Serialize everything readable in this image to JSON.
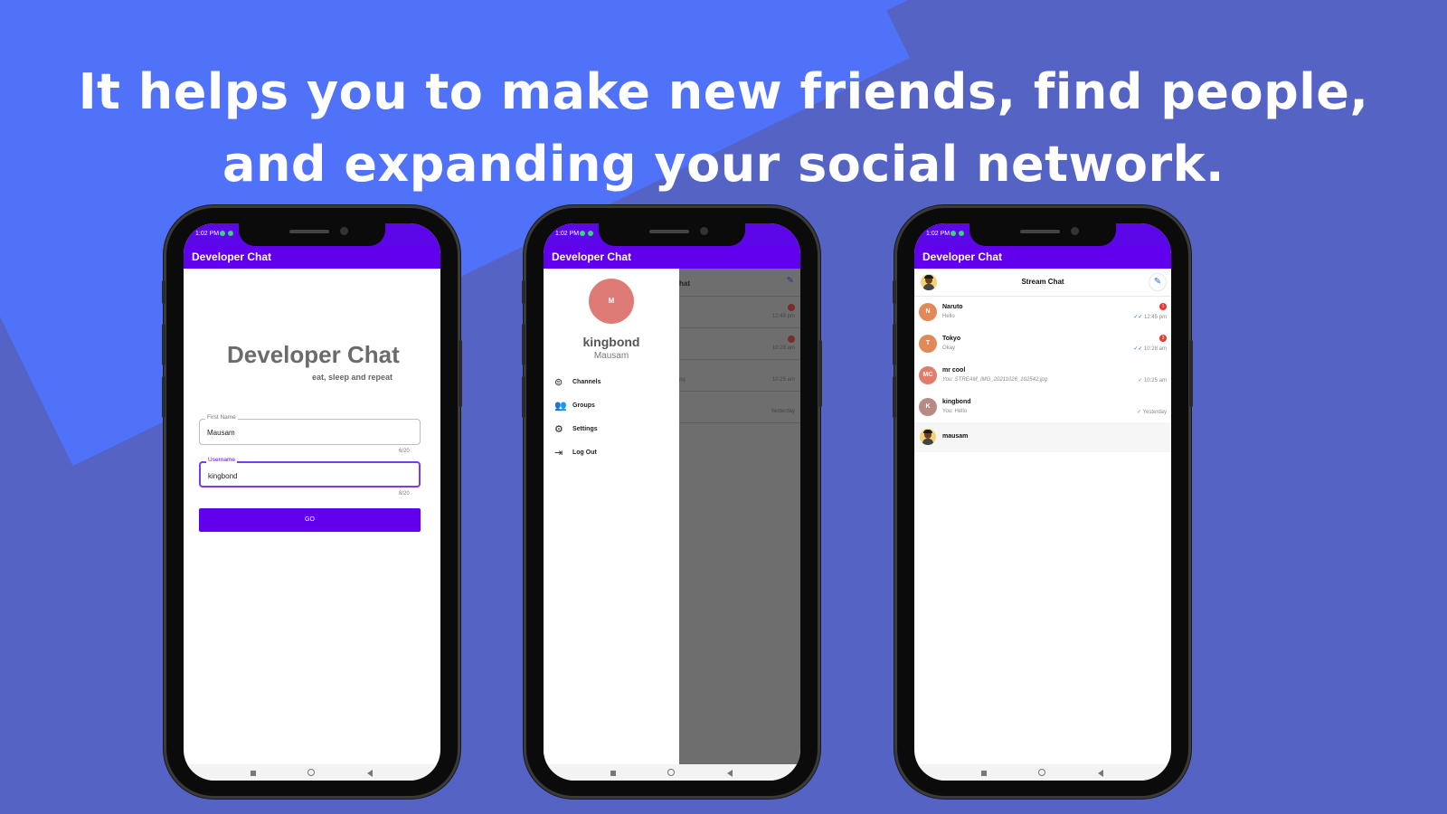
{
  "headline": {
    "line1": "It helps you to make new friends, find people,",
    "line2": "and expanding your social network."
  },
  "colors": {
    "accent": "#6200ee",
    "background": "#4f72f8",
    "unread_badge": "#e53935"
  },
  "status_bar": {
    "time": "1:02 PM"
  },
  "app_bar": {
    "title": "Developer Chat"
  },
  "login": {
    "title": "Developer Chat",
    "subtitle": "eat, sleep and repeat",
    "first_name_label": "First Name",
    "first_name_value": "Mausam",
    "first_name_counter": "6/20",
    "username_label": "Username",
    "username_value": "kingbond",
    "username_counter": "8/20",
    "go_label": "GO"
  },
  "drawer": {
    "avatar_initial": "M",
    "name": "kingbond",
    "username": "Mausam",
    "items": [
      {
        "label": "Channels",
        "icon": "channels-icon"
      },
      {
        "label": "Groups",
        "icon": "groups-icon"
      },
      {
        "label": "Settings",
        "icon": "gear-icon"
      },
      {
        "label": "Log Out",
        "icon": "logout-icon"
      }
    ],
    "background_header_fragment": "hat",
    "background_times": [
      "12:45 pm",
      "10:28 am",
      "10:25 am",
      "Yesterday"
    ],
    "background_msg_fragment": "pg"
  },
  "chat_list": {
    "title": "Stream Chat",
    "rows": [
      {
        "initials": "N",
        "name": "Naruto",
        "message": "Hello",
        "time": "12:45 pm",
        "unread": "1",
        "color": "#e2895a"
      },
      {
        "initials": "T",
        "name": "Tokyo",
        "message": "Okay",
        "time": "10:28 am",
        "unread": "3",
        "color": "#e2895a"
      },
      {
        "initials": "MC",
        "name": "mr cool",
        "message": "You: STREAM_IMG_20211026_102542.jpg",
        "time": "10:25 am",
        "unread": "",
        "color": "#e07d6a"
      },
      {
        "initials": "K",
        "name": "kingbond",
        "message": "You: Hello",
        "time": "Yesterday",
        "unread": "",
        "color": "#b98a83"
      }
    ],
    "self_name": "mausam"
  }
}
